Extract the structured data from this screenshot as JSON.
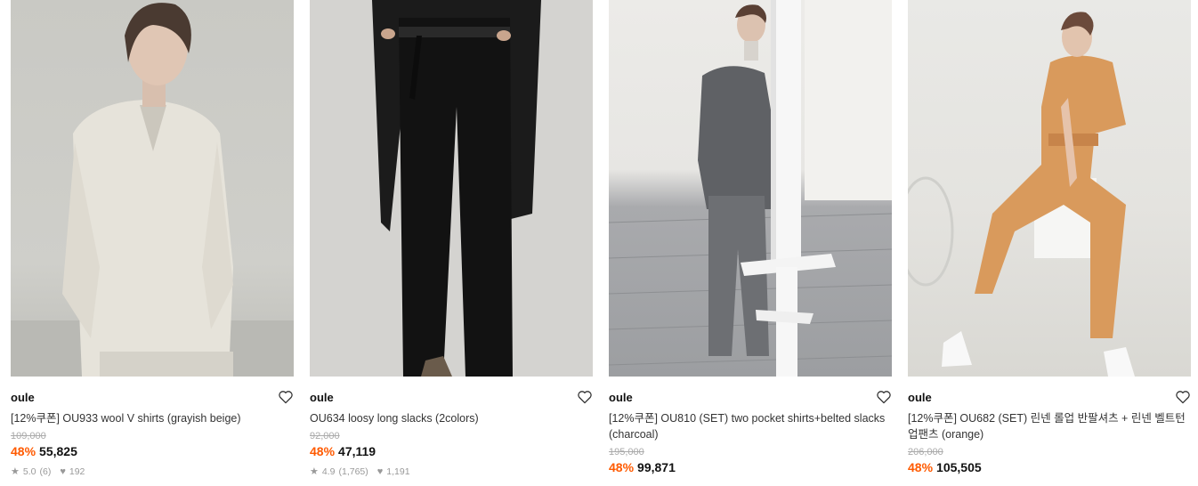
{
  "products": [
    {
      "brand": "oule",
      "title": "[12%쿠폰] OU933 wool V shirts (grayish beige)",
      "original_price": "109,000",
      "discount": "48%",
      "price": "55,825",
      "rating": "5.0",
      "reviews": "(6)",
      "likes": "192",
      "image_label": "model in grayish beige wool shirt"
    },
    {
      "brand": "oule",
      "title": "OU634 loosy long slacks (2colors)",
      "original_price": "92,000",
      "discount": "48%",
      "price": "47,119",
      "rating": "4.9",
      "reviews": "(1,765)",
      "likes": "1,191",
      "image_label": "black long slacks"
    },
    {
      "brand": "oule",
      "title": "[12%쿠폰] OU810 (SET) two pocket shirts+belted slacks (charcoal)",
      "original_price": "195,000",
      "discount": "48%",
      "price": "99,871",
      "image_label": "model in charcoal shirt and slacks set"
    },
    {
      "brand": "oule",
      "title": "[12%쿠폰] OU682 (SET) 린넨 롤업 반팔셔츠 + 린넨 벨트턴업팬츠 (orange)",
      "original_price": "206,000",
      "discount": "48%",
      "price": "105,505",
      "image_label": "model in orange linen set"
    }
  ],
  "colors": {
    "discount": "#ff5a00",
    "muted": "#999999"
  },
  "icons": {
    "wishlist": "heart-outline-icon",
    "rating": "star-icon",
    "likes": "heart-icon"
  }
}
